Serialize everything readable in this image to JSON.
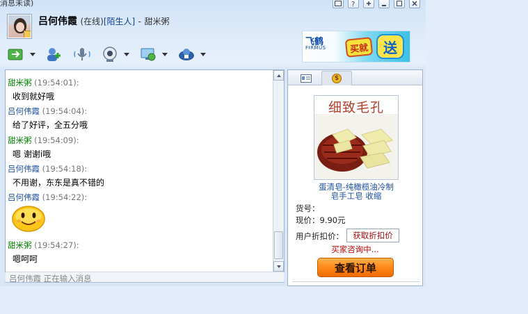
{
  "title_strip": {
    "text": "消息未读)"
  },
  "header": {
    "name": "吕何伟霞",
    "status": "(在线)",
    "stranger_link": "[陌生人]",
    "separator": "-",
    "peer": "甜米粥"
  },
  "toolbar": {
    "icons": [
      "transfer-icon",
      "add-friend-icon",
      "voice-icon",
      "video-icon",
      "remote-assist-icon",
      "app-icon"
    ]
  },
  "ad": {
    "brand": "飞鹤",
    "brand_en": "FIRMUS",
    "buy": "买就",
    "send": "送"
  },
  "messages": [
    {
      "sender": "甜米粥",
      "time": "(19:54:01):",
      "text": "收到就好哦",
      "color": "green"
    },
    {
      "sender": "吕何伟霞",
      "time": "(19:54:04):",
      "text": "给了好评，全五分哦",
      "color": "blue"
    },
    {
      "sender": "甜米粥",
      "time": "(19:54:09):",
      "text": "嗯 谢谢i哦",
      "color": "green"
    },
    {
      "sender": "吕何伟霞",
      "time": "(19:54:18):",
      "text": "不用谢，东东是真不错的",
      "color": "blue"
    },
    {
      "sender": "吕何伟霞",
      "time": "(19:54:22):",
      "emoticon": "smiley-icon",
      "color": "blue"
    },
    {
      "sender": "甜米粥",
      "time": "(19:54:27):",
      "text": "嗯呵呵",
      "color": "green"
    }
  ],
  "typing": {
    "text": "吕何伟霞 正在输入消息"
  },
  "product": {
    "image_caption": "细致毛孔",
    "name_line1": "蛋清皂-纯橄榄油冷制",
    "name_line2": "皂手工皂 收缩",
    "item_no_label": "货号：",
    "price_label": "现价：",
    "price_value": "9.90元",
    "discount_label": "用户折扣价：",
    "discount_button": "获取折扣价",
    "consult": "买家咨询中...",
    "order_button": "查看订单"
  },
  "colors": {
    "sender_green": "#008000",
    "sender_blue": "#1e50a2",
    "accent_orange": "#ff8a1a"
  }
}
